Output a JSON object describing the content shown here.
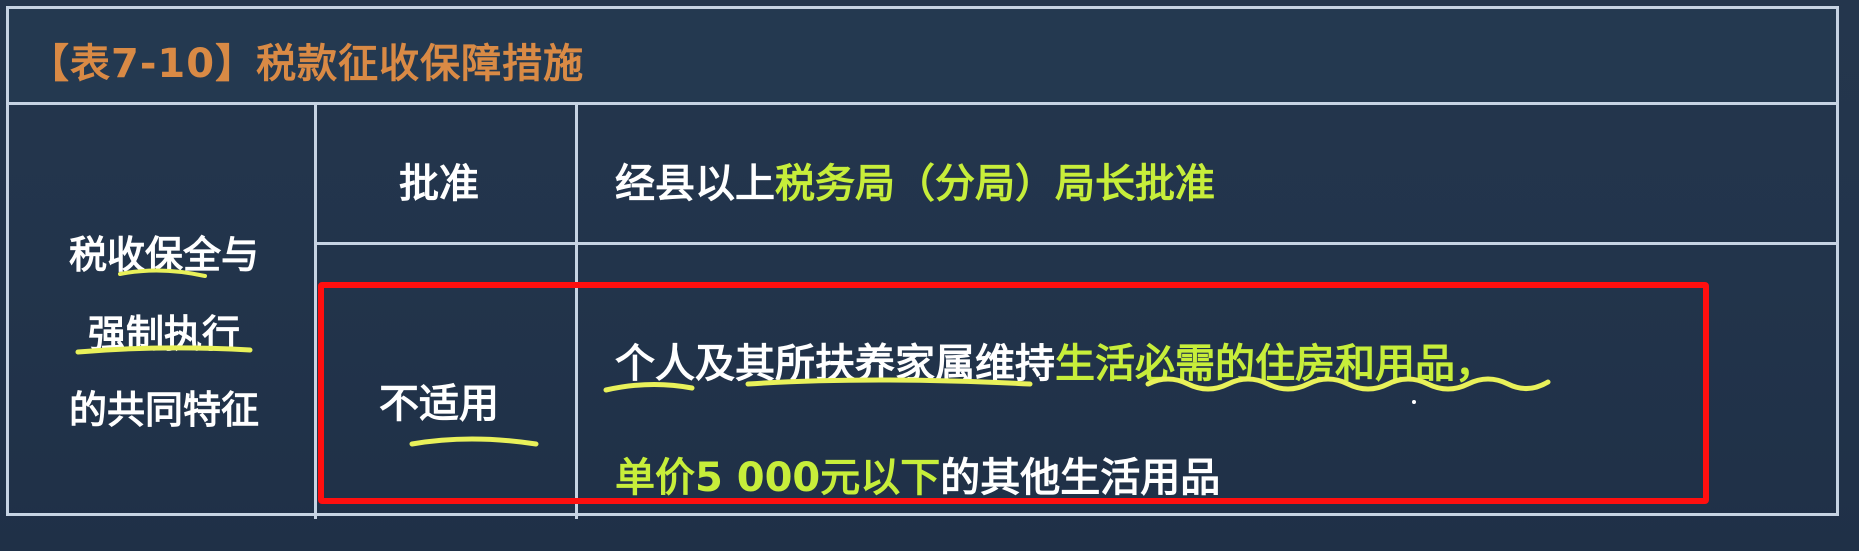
{
  "table": {
    "title": "【表7-10】税款征收保障措施",
    "left_label": {
      "line1": "税收保全与",
      "line2": "强制执行",
      "line3": "的共同特征"
    },
    "rows": [
      {
        "label": "批准",
        "content_plain": "经县以上",
        "content_highlight": "税务局（分局）局长批准"
      },
      {
        "label": "不适用",
        "line1_plain": "个人及其所扶养家属维持",
        "line1_highlight": "生活必需的住房和用品，",
        "line2_highlight": "单价5  000元以下",
        "line2_plain": "的其他生活用品"
      }
    ]
  },
  "colors": {
    "background": "#22344b",
    "grid_line": "#c6d3e3",
    "title_text": "#d98a45",
    "body_text": "#ffffff",
    "highlight_text": "#c7ee3a",
    "annotation_box": "#ff0f0f",
    "handwriting": "#e9f15a"
  }
}
